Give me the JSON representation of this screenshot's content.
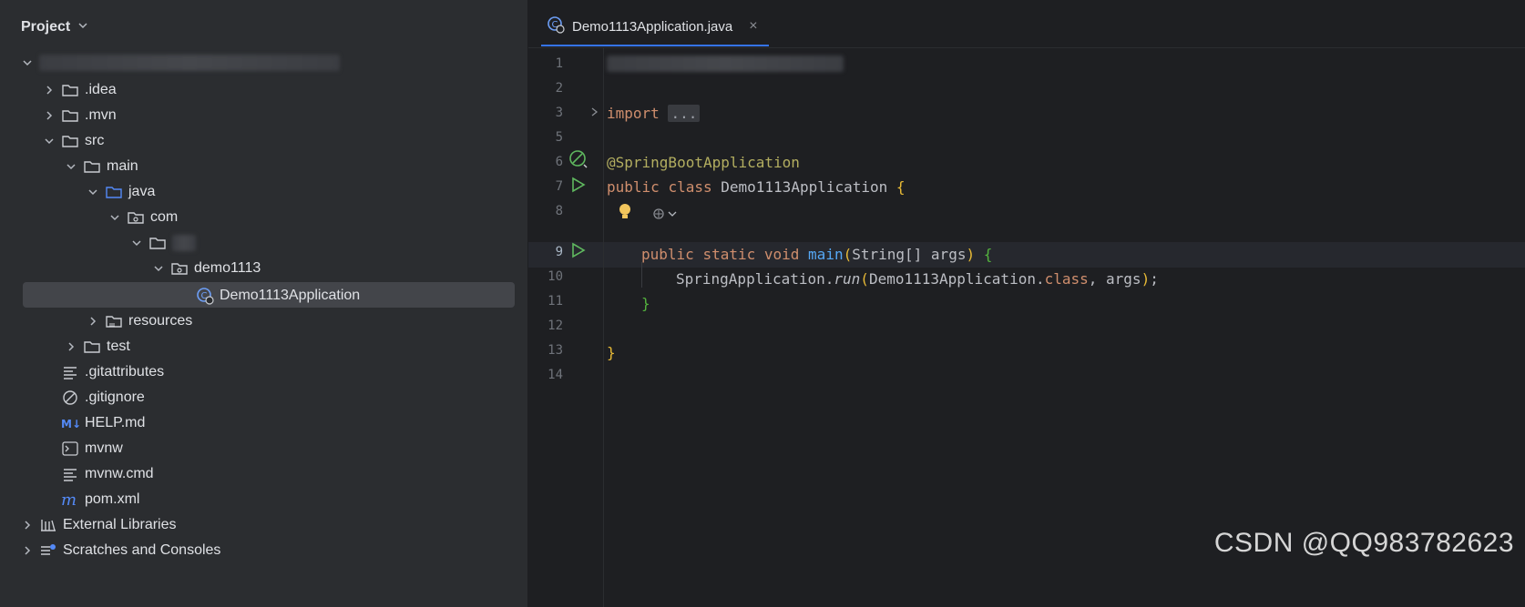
{
  "project": {
    "title": "Project",
    "tree": [
      {
        "label": "",
        "depth": 0,
        "expanded": true,
        "kind": "root-redacted"
      },
      {
        "label": ".idea",
        "depth": 1,
        "expanded": false,
        "kind": "folder"
      },
      {
        "label": ".mvn",
        "depth": 1,
        "expanded": false,
        "kind": "folder"
      },
      {
        "label": "src",
        "depth": 1,
        "expanded": true,
        "kind": "folder"
      },
      {
        "label": "main",
        "depth": 2,
        "expanded": true,
        "kind": "folder"
      },
      {
        "label": "java",
        "depth": 3,
        "expanded": true,
        "kind": "source-folder"
      },
      {
        "label": "com",
        "depth": 4,
        "expanded": true,
        "kind": "package"
      },
      {
        "label": "",
        "depth": 5,
        "expanded": true,
        "kind": "package-redacted"
      },
      {
        "label": "demo1113",
        "depth": 6,
        "expanded": true,
        "kind": "package"
      },
      {
        "label": "Demo1113Application",
        "depth": 7,
        "expanded": null,
        "kind": "spring-class"
      },
      {
        "label": "resources",
        "depth": 3,
        "expanded": false,
        "kind": "resources-folder"
      },
      {
        "label": "test",
        "depth": 2,
        "expanded": false,
        "kind": "folder"
      },
      {
        "label": ".gitattributes",
        "depth": 1,
        "expanded": null,
        "kind": "text-file"
      },
      {
        "label": ".gitignore",
        "depth": 1,
        "expanded": null,
        "kind": "ignore-file"
      },
      {
        "label": "HELP.md",
        "depth": 1,
        "expanded": null,
        "kind": "markdown-file"
      },
      {
        "label": "mvnw",
        "depth": 1,
        "expanded": null,
        "kind": "shell-file"
      },
      {
        "label": "mvnw.cmd",
        "depth": 1,
        "expanded": null,
        "kind": "text-file"
      },
      {
        "label": "pom.xml",
        "depth": 1,
        "expanded": null,
        "kind": "maven-file"
      },
      {
        "label": "External Libraries",
        "depth": 0,
        "expanded": false,
        "kind": "libraries"
      },
      {
        "label": "Scratches and Consoles",
        "depth": 0,
        "expanded": false,
        "kind": "scratches"
      }
    ]
  },
  "editor": {
    "tab_label": "Demo1113Application.java",
    "tab_close": "×",
    "line_numbers": [
      "1",
      "2",
      "3",
      "5",
      "6",
      "7",
      "8",
      "9",
      "10",
      "11",
      "12",
      "13",
      "14"
    ],
    "code": {
      "import_kw": "import",
      "import_fold": "...",
      "annotation": "@SpringBootApplication",
      "class_public": "public",
      "class_kw": "class",
      "class_name": "Demo1113Application",
      "open_brace": "{",
      "main_public": "public",
      "main_static": "static",
      "main_void": "void",
      "main_name": "main",
      "main_lparen": "(",
      "main_param_type": "String[]",
      "main_param_name": "args",
      "main_rparen": ")",
      "main_brace": "{",
      "run_target": "SpringApplication.",
      "run_method": "run",
      "run_lparen": "(",
      "run_arg_class": "Demo1113Application.",
      "run_arg_kw": "class",
      "run_arg_rest": ", args",
      "run_rparen": ")",
      "run_semicolon": ";",
      "main_close": "}",
      "class_close": "}"
    }
  },
  "watermark": "CSDN @QQ983782623",
  "colors": {
    "panel_bg": "#2b2d30",
    "editor_bg": "#1e1f22",
    "keyword": "#cf8e6d",
    "annotation": "#b3ae60",
    "function": "#56a8f5",
    "accent": "#3574f0"
  }
}
